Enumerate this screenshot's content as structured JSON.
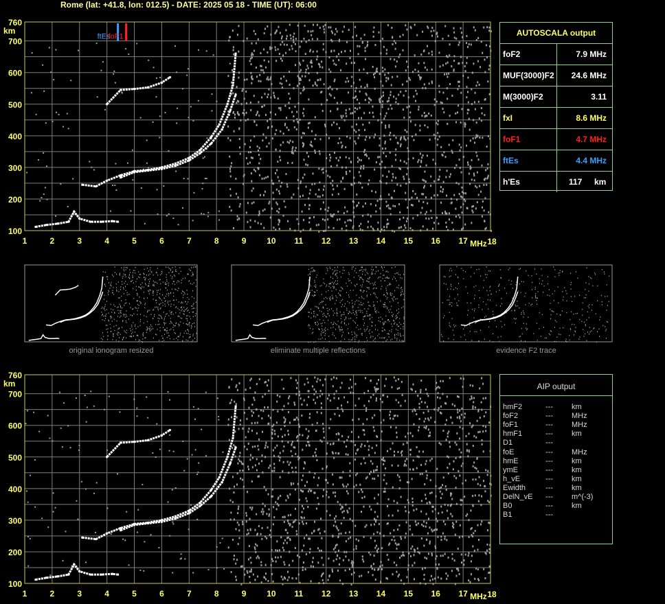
{
  "header": {
    "text": "Rome (lat: +41.8, lon: 012.5) - DATE: 2025 05 18 - TIME (UT): 06:00"
  },
  "colors": {
    "trace": "#ffffff",
    "noise": "#a0a0a0",
    "grid": "#808080",
    "axis": "#ffff66",
    "fxI": "#ffff66",
    "foF1": "#ff2020",
    "ftEs": "#3aa0ff",
    "panel_border": "#8fd48f"
  },
  "chart_data": [
    {
      "type": "scatter",
      "title": "",
      "xlabel": "MHz",
      "ylabel": "km",
      "xlim": [
        1,
        18
      ],
      "ylim": [
        100,
        760
      ],
      "x_ticks": [
        "1",
        "2",
        "3",
        "4",
        "5",
        "6",
        "7",
        "8",
        "9",
        "10",
        "11",
        "12",
        "13",
        "14",
        "15",
        "16",
        "17",
        "18"
      ],
      "y_ticks": [
        "760",
        "700",
        "600",
        "500",
        "400",
        "300",
        "200",
        "100"
      ],
      "grid": true,
      "markers": [
        {
          "label": "ftEs",
          "freq": 4.4,
          "color": "#3aa0ff"
        },
        {
          "label": "foF1",
          "freq": 4.7,
          "color": "#ff2020"
        }
      ],
      "series": [
        {
          "name": "",
          "role": "O-trace F2",
          "x": [
            3.1,
            3.6,
            4.0,
            4.5,
            5.0,
            5.5,
            6.0,
            6.5,
            7.0,
            7.4,
            7.8,
            8.1,
            8.4,
            8.6,
            8.7
          ],
          "y": [
            245,
            240,
            258,
            275,
            288,
            292,
            300,
            312,
            330,
            355,
            395,
            435,
            500,
            560,
            660
          ]
        },
        {
          "name": "",
          "role": "X-trace F2",
          "x": [
            4.5,
            5.0,
            5.5,
            6.0,
            6.5,
            7.0,
            7.4,
            7.8,
            8.2,
            8.5,
            8.7
          ],
          "y": [
            268,
            285,
            290,
            295,
            305,
            322,
            345,
            375,
            420,
            480,
            530
          ]
        },
        {
          "name": "",
          "role": "E/Es trace",
          "x": [
            1.4,
            1.8,
            2.2,
            2.6,
            2.8,
            3.0,
            3.4,
            3.8,
            4.2,
            4.4
          ],
          "y": [
            112,
            118,
            122,
            128,
            160,
            138,
            128,
            128,
            130,
            128
          ]
        },
        {
          "name": "",
          "role": "multiple reflection",
          "x": [
            4.0,
            4.5,
            5.0,
            5.5,
            6.0,
            6.3
          ],
          "y": [
            500,
            545,
            548,
            553,
            568,
            585
          ]
        }
      ]
    },
    {
      "type": "scatter",
      "title": "",
      "xlabel": "MHz",
      "ylabel": "km",
      "xlim": [
        1,
        18
      ],
      "ylim": [
        100,
        760
      ],
      "x_ticks": [
        "1",
        "2",
        "3",
        "4",
        "5",
        "6",
        "7",
        "8",
        "9",
        "10",
        "11",
        "12",
        "13",
        "14",
        "15",
        "16",
        "17",
        "18"
      ],
      "y_ticks": [
        "760",
        "700",
        "600",
        "500",
        "400",
        "300",
        "200",
        "100"
      ],
      "grid": true,
      "series": [
        {
          "name": "",
          "role": "O-trace F2",
          "x": [
            3.1,
            3.6,
            4.0,
            4.5,
            5.0,
            5.5,
            6.0,
            6.5,
            7.0,
            7.4,
            7.8,
            8.1,
            8.4,
            8.6,
            8.7
          ],
          "y": [
            245,
            240,
            258,
            275,
            288,
            292,
            300,
            312,
            330,
            355,
            395,
            435,
            500,
            560,
            660
          ]
        },
        {
          "name": "",
          "role": "X-trace F2",
          "x": [
            4.5,
            5.0,
            5.5,
            6.0,
            6.5,
            7.0,
            7.4,
            7.8,
            8.2,
            8.5,
            8.7
          ],
          "y": [
            268,
            285,
            290,
            295,
            305,
            322,
            345,
            375,
            420,
            480,
            530
          ]
        },
        {
          "name": "",
          "role": "E/Es trace",
          "x": [
            1.4,
            1.8,
            2.2,
            2.6,
            2.8,
            3.0,
            3.4,
            3.8,
            4.2,
            4.4
          ],
          "y": [
            112,
            118,
            122,
            128,
            160,
            138,
            128,
            128,
            130,
            128
          ]
        },
        {
          "name": "",
          "role": "multiple reflection",
          "x": [
            4.0,
            4.5,
            5.0,
            5.5,
            6.0,
            6.3
          ],
          "y": [
            500,
            545,
            548,
            553,
            568,
            585
          ]
        }
      ]
    }
  ],
  "thumbnails": [
    {
      "caption": "original ionogram resized"
    },
    {
      "caption": "eliminate multiple reflections"
    },
    {
      "caption": "evidence F2 trace"
    }
  ],
  "autoscala": {
    "title": "AUTOSCALA output",
    "rows": [
      {
        "label": "foF2",
        "value": "7.9 MHz",
        "color": "#ffffff"
      },
      {
        "label": "MUF(3000)F2",
        "value": "24.6 MHz",
        "color": "#ffffff"
      },
      {
        "label": "M(3000)F2",
        "value": "3.11",
        "color": "#ffffff"
      },
      {
        "label": "fxI",
        "value": "8.6 MHz",
        "color": "#ffff66"
      },
      {
        "label": "foF1",
        "value": "4.7 MHz",
        "color": "#ff2020"
      },
      {
        "label": "ftEs",
        "value": "4.4 MHz",
        "color": "#3aa0ff"
      },
      {
        "label": "h'Es",
        "value": "117",
        "unit": "km",
        "color": "#ffffff"
      }
    ]
  },
  "aip": {
    "title": "AIP output",
    "rows": [
      {
        "label": "hmF2",
        "value": "---",
        "unit": "km"
      },
      {
        "label": "foF2",
        "value": "---",
        "unit": "MHz"
      },
      {
        "label": "foF1",
        "value": "---",
        "unit": "MHz"
      },
      {
        "label": "hmF1",
        "value": "---",
        "unit": "km"
      },
      {
        "label": "D1",
        "value": "---",
        "unit": ""
      },
      {
        "label": "foE",
        "value": "---",
        "unit": "MHz"
      },
      {
        "label": "hmE",
        "value": "---",
        "unit": "km"
      },
      {
        "label": "ymE",
        "value": "---",
        "unit": "km"
      },
      {
        "label": "h_vE",
        "value": "---",
        "unit": "km"
      },
      {
        "label": "Ewidth",
        "value": "---",
        "unit": "km"
      },
      {
        "label": "DelN_vE",
        "value": "---",
        "unit": "m^(-3)"
      },
      {
        "label": "B0",
        "value": "---",
        "unit": "km"
      },
      {
        "label": "B1",
        "value": "---",
        "unit": ""
      }
    ]
  }
}
